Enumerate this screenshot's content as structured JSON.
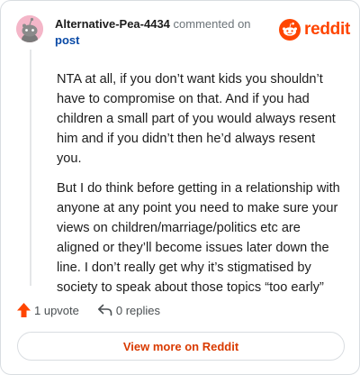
{
  "header": {
    "author": "Alternative-Pea-4434",
    "commented_on": "commented on",
    "post_link": "post"
  },
  "brand": {
    "name": "reddit",
    "color": "#ff4500"
  },
  "comment": {
    "paragraphs": [
      "NTA at all, if you don’t want kids you shouldn’t have to compromise on that. And if you had children a small part of you would always resent him and if you didn’t then he’d always resent you.",
      "But I do think before getting in a relationship with anyone at any point you need to make sure your views on children/marriage/politics etc are aligned or they’ll become issues later down the line. I don’t really get why it’s stigmatised by society to speak about those topics “too early”"
    ]
  },
  "actions": {
    "upvote_label": "1 upvote",
    "upvote_icon": "upvote-arrow-icon",
    "replies_label": "0 replies",
    "replies_icon": "reply-arrow-icon"
  },
  "footer": {
    "view_more_label": "View more on Reddit"
  },
  "colors": {
    "accent": "#ff4500",
    "link": "#0a4aa6",
    "view_more": "#d93a00"
  }
}
